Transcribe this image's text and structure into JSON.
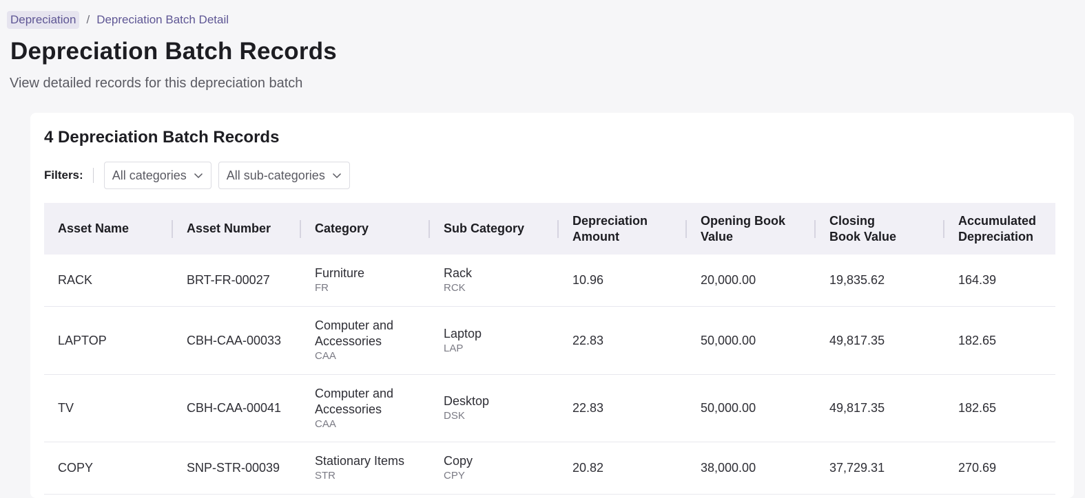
{
  "breadcrumb": {
    "parent": "Depreciation",
    "separator": "/",
    "current": "Depreciation Batch Detail"
  },
  "page": {
    "title": "Depreciation Batch Records",
    "subtitle": "View detailed records for this depreciation batch"
  },
  "card": {
    "title": "4 Depreciation Batch Records"
  },
  "filters": {
    "label": "Filters:",
    "category_select": "All categories",
    "subcategory_select": "All sub-categories"
  },
  "table": {
    "headers": [
      "Asset Name",
      "Asset Number",
      "Category",
      "Sub Category",
      "Depreciation Amount",
      "Opening Book Value",
      "Closing Book Value",
      "Accumulated Depreciation"
    ],
    "rows": [
      {
        "asset_name": "RACK",
        "asset_number": "BRT-FR-00027",
        "category": "Furniture",
        "category_code": "FR",
        "sub_category": "Rack",
        "sub_category_code": "RCK",
        "depreciation_amount": "10.96",
        "opening_book_value": "20,000.00",
        "closing_book_value": "19,835.62",
        "accumulated_depreciation": "164.39"
      },
      {
        "asset_name": "LAPTOP",
        "asset_number": "CBH-CAA-00033",
        "category": "Computer and Accessories",
        "category_code": "CAA",
        "sub_category": "Laptop",
        "sub_category_code": "LAP",
        "depreciation_amount": "22.83",
        "opening_book_value": "50,000.00",
        "closing_book_value": "49,817.35",
        "accumulated_depreciation": "182.65"
      },
      {
        "asset_name": "TV",
        "asset_number": "CBH-CAA-00041",
        "category": "Computer and Accessories",
        "category_code": "CAA",
        "sub_category": "Desktop",
        "sub_category_code": "DSK",
        "depreciation_amount": "22.83",
        "opening_book_value": "50,000.00",
        "closing_book_value": "49,817.35",
        "accumulated_depreciation": "182.65"
      },
      {
        "asset_name": "COPY",
        "asset_number": "SNP-STR-00039",
        "category": "Stationary Items",
        "category_code": "STR",
        "sub_category": "Copy",
        "sub_category_code": "CPY",
        "depreciation_amount": "20.82",
        "opening_book_value": "38,000.00",
        "closing_book_value": "37,729.31",
        "accumulated_depreciation": "270.69"
      }
    ]
  },
  "icons": {
    "dropdown": "chevron-down-icon"
  },
  "colors": {
    "accent": "#5e5694",
    "header_bg": "#f1f0f6",
    "page_bg": "#f6f6f8"
  }
}
